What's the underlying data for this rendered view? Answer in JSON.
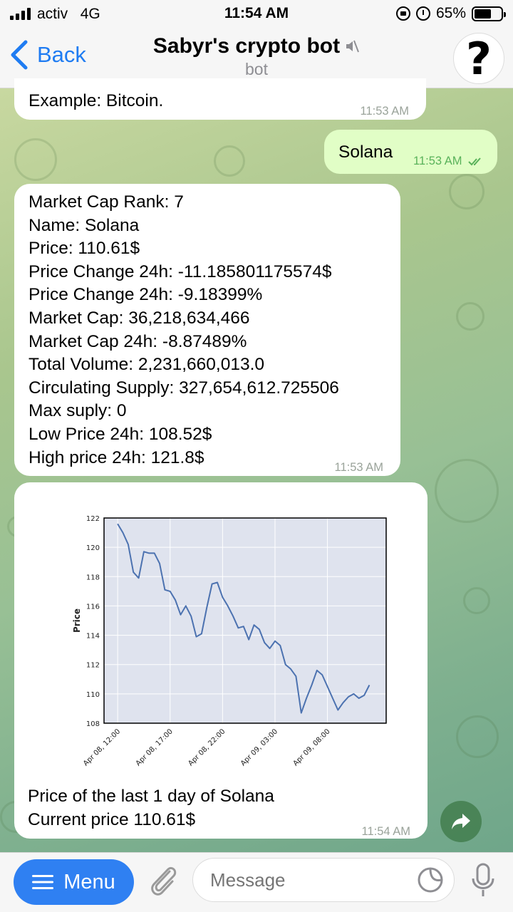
{
  "status_bar": {
    "carrier": "activ",
    "network": "4G",
    "time": "11:54 AM",
    "battery": "65%",
    "battery_level": 0.65
  },
  "header": {
    "back_label": "Back",
    "title": "Sabyr's crypto bot",
    "subtitle": "bot",
    "avatar_glyph": "?"
  },
  "messages": [
    {
      "direction": "in",
      "text": "Example: Bitcoin.",
      "time": "11:53 AM"
    },
    {
      "direction": "out",
      "text": "Solana",
      "time": "11:53 AM"
    },
    {
      "direction": "in",
      "lines": [
        "Market Cap Rank: 7",
        "Name: Solana",
        "Price: 110.61$",
        "Price Change 24h: -11.185801175574$",
        "Price Change 24h: -9.18399%",
        "Market Cap: 36,218,634,466",
        "Market Cap 24h: -8.87489%",
        "Total Volume: 2,231,660,013.0",
        "Circulating Supply: 327,654,612.725506",
        "Max suply: 0",
        "Low Price 24h: 108.52$",
        "High price 24h: 121.8$"
      ],
      "time": "11:53 AM"
    },
    {
      "direction": "in",
      "caption_lines": [
        "Price of the last 1 day of Solana",
        "Current price 110.61$"
      ],
      "time": "11:54 AM"
    }
  ],
  "chart_data": {
    "type": "line",
    "title": "",
    "xlabel": "",
    "ylabel": "Price",
    "ylim": [
      108,
      122
    ],
    "yticks": [
      108,
      110,
      112,
      114,
      116,
      118,
      120,
      122
    ],
    "xticks": [
      "Apr 08, 12:00",
      "Apr 08, 17:00",
      "Apr 08, 22:00",
      "Apr 09, 03:00",
      "Apr 09, 08:00"
    ],
    "xtick_hours": [
      0,
      5,
      10,
      15,
      20
    ],
    "x_hours": [
      0,
      0.5,
      1,
      1.5,
      2,
      2.5,
      3,
      3.5,
      4,
      4.5,
      5,
      5.5,
      6,
      6.5,
      7,
      7.5,
      8,
      8.5,
      9,
      9.5,
      10,
      10.5,
      11,
      11.5,
      12,
      12.5,
      13,
      13.5,
      14,
      14.5,
      15,
      15.5,
      16,
      16.5,
      17,
      17.5,
      18,
      18.5,
      19,
      19.5,
      20,
      20.5,
      21,
      21.5,
      22,
      22.5,
      23,
      23.5,
      24
    ],
    "series": [
      {
        "values": [
          121.6,
          121.0,
          120.2,
          118.3,
          117.9,
          119.7,
          119.6,
          119.6,
          118.9,
          117.1,
          117.0,
          116.4,
          115.4,
          116.0,
          115.3,
          113.9,
          114.1,
          115.9,
          117.5,
          117.6,
          116.6,
          116.0,
          115.3,
          114.5,
          114.6,
          113.7,
          114.7,
          114.4,
          113.5,
          113.1,
          113.6,
          113.3,
          112.0,
          111.7,
          111.2,
          108.7,
          109.7,
          110.6,
          111.6,
          111.3,
          110.5,
          109.7,
          108.9,
          109.4,
          109.8,
          110.0,
          109.7,
          109.9,
          110.6
        ]
      }
    ],
    "grid": true,
    "colors": {
      "line": "#4c72b0",
      "plot_bg": "#dfe3ee",
      "grid": "#ffffff"
    }
  },
  "input_bar": {
    "menu_label": "Menu",
    "placeholder": "Message"
  },
  "colors": {
    "accent": "#1f7cf2",
    "menu_button": "#2f80f2",
    "outgoing_bubble": "#e1fec6",
    "incoming_bubble": "#ffffff"
  }
}
